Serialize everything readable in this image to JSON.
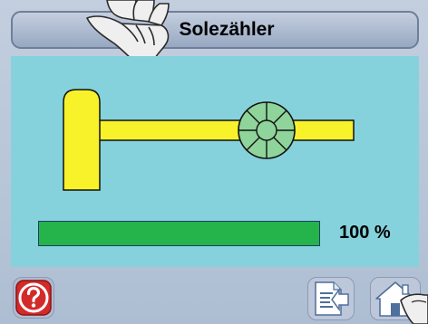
{
  "title": "Solezähler",
  "progress": {
    "value_fraction": 1.0,
    "label": "100 %"
  },
  "icons": {
    "help": "question-mark-icon",
    "back": "back-arrow-icon",
    "home": "home-icon",
    "pointer": "hand-pointer-icon"
  },
  "colors": {
    "content_bg": "#86d2dc",
    "meter_yellow": "#f7f22a",
    "wheel_green": "#8fd49a",
    "progress_green": "#25b34c",
    "help_red": "#d42a2a"
  }
}
